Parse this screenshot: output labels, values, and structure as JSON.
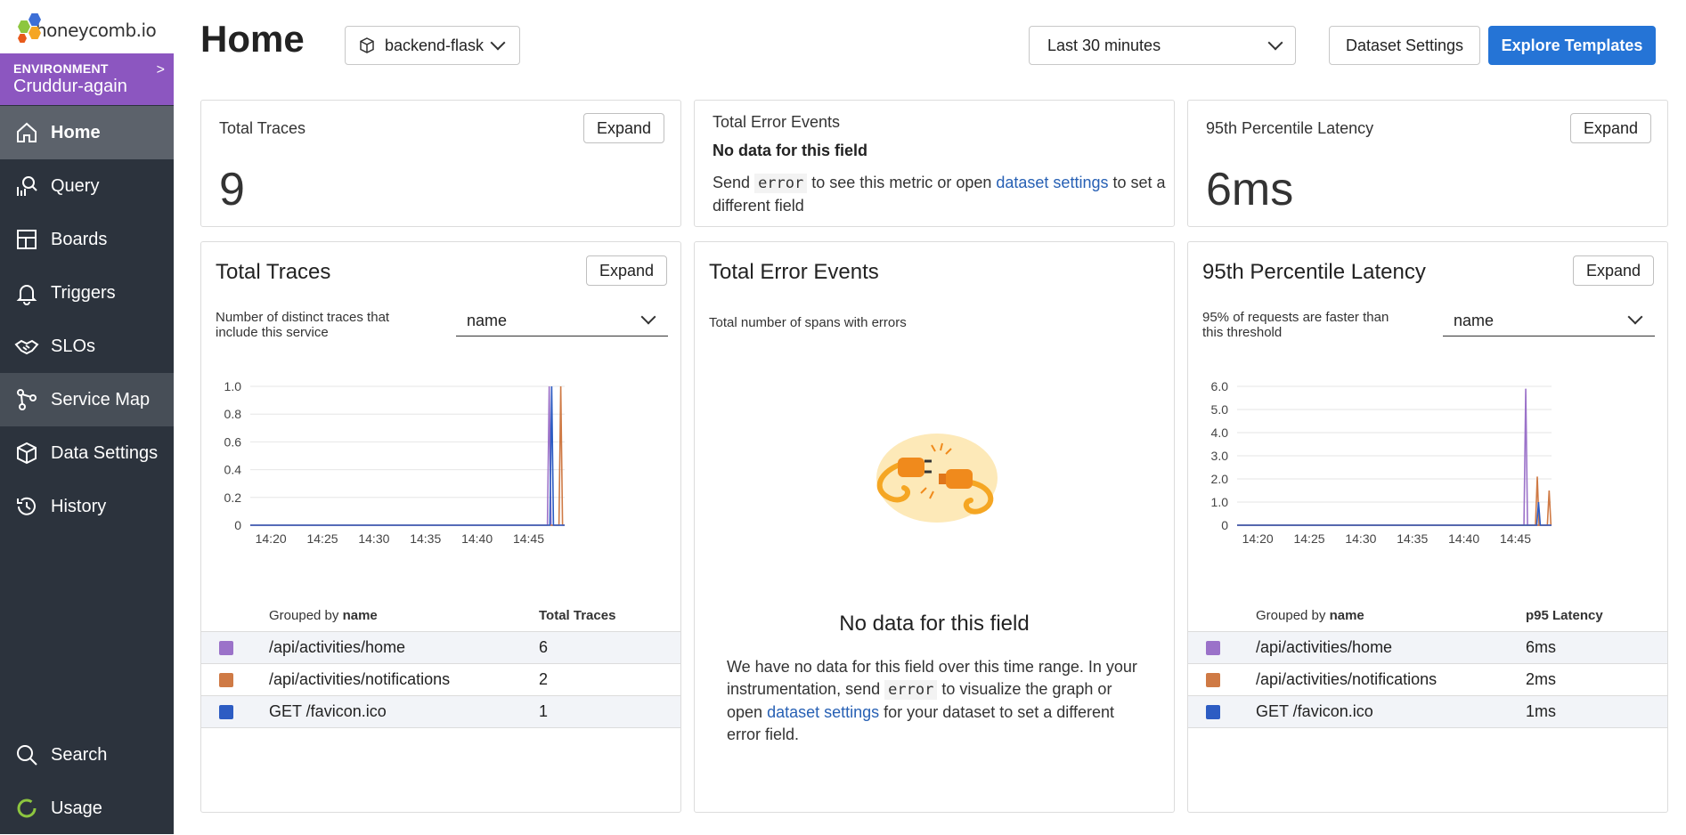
{
  "app": {
    "logo_text": "honeycomb.io"
  },
  "environment": {
    "label": "ENVIRONMENT",
    "name": "Cruddur-again"
  },
  "nav": {
    "items": [
      {
        "label": "Home",
        "icon": "home-icon"
      },
      {
        "label": "Query",
        "icon": "query-icon"
      },
      {
        "label": "Boards",
        "icon": "boards-icon"
      },
      {
        "label": "Triggers",
        "icon": "bell-icon"
      },
      {
        "label": "SLOs",
        "icon": "handshake-icon"
      },
      {
        "label": "Service Map",
        "icon": "service-map-icon"
      },
      {
        "label": "Data Settings",
        "icon": "cube-icon"
      },
      {
        "label": "History",
        "icon": "history-icon"
      }
    ],
    "bottom": [
      {
        "label": "Search",
        "icon": "search-icon"
      },
      {
        "label": "Usage",
        "icon": "usage-ring-icon"
      }
    ]
  },
  "header": {
    "title": "Home",
    "dataset": "backend-flask",
    "time_range": "Last 30 minutes",
    "dataset_settings": "Dataset Settings",
    "explore_templates": "Explore Templates"
  },
  "summary": {
    "traces": {
      "title": "Total Traces",
      "value": "9",
      "expand": "Expand"
    },
    "errors": {
      "title": "Total Error Events",
      "no_data": "No data for this field",
      "msg_send": "Send",
      "msg_code": "error",
      "msg_mid": "to see this metric or open",
      "msg_link": "dataset settings",
      "msg_end": "to set a different field"
    },
    "latency": {
      "title": "95th Percentile Latency",
      "value": "6ms",
      "expand": "Expand"
    }
  },
  "cards": {
    "traces": {
      "title": "Total Traces",
      "expand": "Expand",
      "desc": "Number of distinct traces that include this service",
      "group": "name",
      "col_group_prefix": "Grouped by",
      "col_group_name": "name",
      "col_value": "Total Traces",
      "rows": [
        {
          "name": "/api/activities/home",
          "value": "6"
        },
        {
          "name": "/api/activities/notifications",
          "value": "2"
        },
        {
          "name": "GET /favicon.ico",
          "value": "1"
        }
      ]
    },
    "errors": {
      "title": "Total Error Events",
      "desc": "Total number of spans with errors",
      "empty_title": "No data for this field",
      "p1": "We have no data for this field over this time range. In your instrumentation, send",
      "p_code": "error",
      "p2": "to visualize the graph or open",
      "p_link": "dataset settings",
      "p3": "for your dataset to set a different error field."
    },
    "latency": {
      "title": "95th Percentile Latency",
      "expand": "Expand",
      "desc": "95% of requests are faster than this threshold",
      "group": "name",
      "col_group_prefix": "Grouped by",
      "col_group_name": "name",
      "col_value": "p95 Latency",
      "rows": [
        {
          "name": "/api/activities/home",
          "value": "6ms"
        },
        {
          "name": "/api/activities/notifications",
          "value": "2ms"
        },
        {
          "name": "GET /favicon.ico",
          "value": "1ms"
        }
      ]
    }
  },
  "colors": {
    "home": "#9b72c9",
    "notifications": "#cf7a45",
    "favicon": "#2d5cc3",
    "accent": "#2574d6",
    "env": "#8c56c0"
  },
  "chart_data": [
    {
      "type": "line",
      "x": [
        "14:20",
        "14:25",
        "14:30",
        "14:35",
        "14:40",
        "14:45"
      ],
      "ylim": [
        0,
        1.0
      ],
      "yticks": [
        "1.0",
        "0.8",
        "0.6",
        "0.4",
        "0.2",
        "0"
      ],
      "series": [
        {
          "name": "/api/activities/home",
          "spikes": [
            {
              "t": "14:47",
              "v": 1.0
            }
          ]
        },
        {
          "name": "/api/activities/notifications",
          "spikes": [
            {
              "t": "14:48",
              "v": 1.0
            }
          ]
        },
        {
          "name": "GET /favicon.ico",
          "spikes": [
            {
              "t": "14:47",
              "v": 1.0
            }
          ]
        }
      ]
    },
    {
      "type": "line",
      "x": [
        "14:20",
        "14:25",
        "14:30",
        "14:35",
        "14:40",
        "14:45"
      ],
      "ylim": [
        0,
        6.0
      ],
      "yticks": [
        "6.0",
        "5.0",
        "4.0",
        "3.0",
        "2.0",
        "1.0",
        "0"
      ],
      "series": [
        {
          "name": "/api/activities/home",
          "spikes": [
            {
              "t": "14:46",
              "v": 5.9
            }
          ]
        },
        {
          "name": "/api/activities/notifications",
          "spikes": [
            {
              "t": "14:47",
              "v": 2.1
            },
            {
              "t": "14:48",
              "v": 1.5
            }
          ]
        },
        {
          "name": "GET /favicon.ico",
          "spikes": [
            {
              "t": "14:47",
              "v": 1.0
            }
          ]
        }
      ]
    }
  ]
}
